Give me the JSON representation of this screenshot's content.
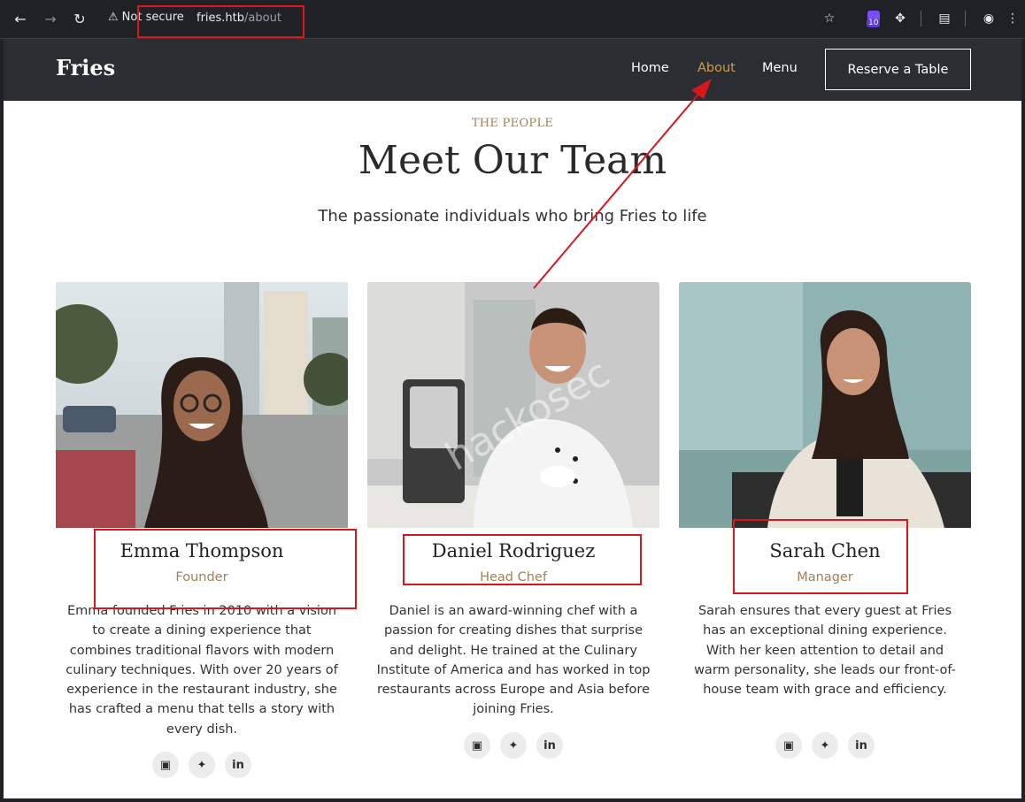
{
  "browser": {
    "security_label": "Not secure",
    "url_host": "fries.htb",
    "url_path": "/about",
    "extension_count": "10"
  },
  "site": {
    "logo": "Fries",
    "nav": [
      {
        "label": "Home",
        "active": false
      },
      {
        "label": "About",
        "active": true
      },
      {
        "label": "Menu",
        "active": false
      }
    ],
    "cta": "Reserve a Table"
  },
  "section": {
    "eyebrow": "THE PEOPLE",
    "title": "Meet Our Team",
    "subtitle": "The passionate individuals who bring Fries to life"
  },
  "team": [
    {
      "name": "Emma Thompson",
      "role": "Founder",
      "bio": "Emma founded Fries in 2010 with a vision to create a dining experience that combines traditional flavors with modern culinary techniques. With over 20 years of experience in the restaurant industry, she has crafted a menu that tells a story with every dish.",
      "socials": [
        "instagram-icon",
        "twitter-icon",
        "linkedin-icon"
      ]
    },
    {
      "name": "Daniel Rodriguez",
      "role": "Head Chef",
      "bio": "Daniel is an award-winning chef with a passion for creating dishes that surprise and delight. He trained at the Culinary Institute of America and has worked in top restaurants across Europe and Asia before joining Fries.",
      "socials": [
        "instagram-icon",
        "twitter-icon",
        "linkedin-icon"
      ]
    },
    {
      "name": "Sarah Chen",
      "role": "Manager",
      "bio": "Sarah ensures that every guest at Fries has an exceptional dining experience. With her keen attention to detail and warm personality, she leads our front-of-house team with grace and efficiency.",
      "socials": [
        "instagram-icon",
        "twitter-icon",
        "linkedin-icon"
      ]
    }
  ],
  "watermark": "hackosec",
  "colors": {
    "header_bg": "#2a2d31",
    "accent": "#d99a3e",
    "role": "#a0805a",
    "annotation": "#d9161c"
  }
}
